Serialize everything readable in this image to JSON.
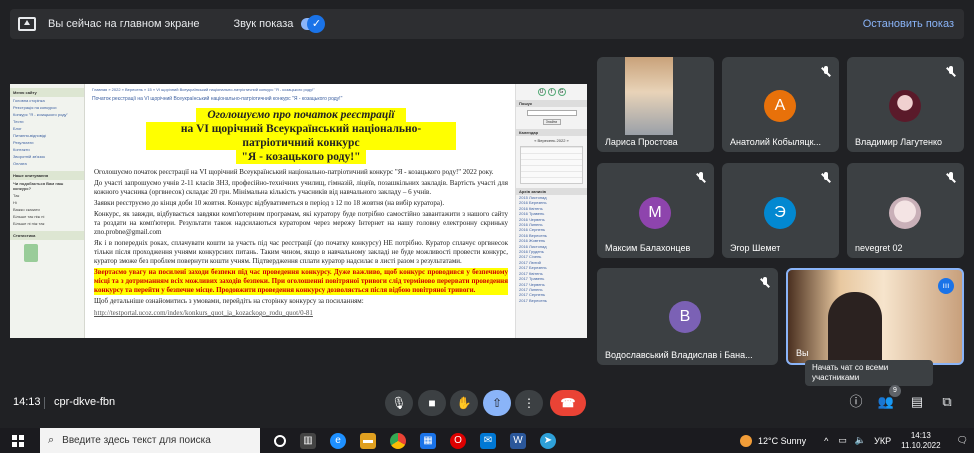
{
  "top_bar": {
    "presenting_text": "Вы сейчас на главном экране",
    "sound_label": "Звук показа",
    "stop_label": "Остановить показ"
  },
  "shared_screen": {
    "breadcrumb": "Главная » 2022 » Вересень » 15 » VI щорічний Всеукраїнський національно-патріотичний конкурс \"Я - козацького роду!\"",
    "page_title": "Початок реєстрації на VI щорічний Всеукраїнський національно-патріотичний конкурс \"Я - козацького роду!\"",
    "heading1": "Оголошуємо про початок реєстрації",
    "heading2": "на VI щорічний Всеукраїнський національно-патріотичний конкурс",
    "heading3": "\"Я - козацького роду!\"",
    "p1": "Оголошуємо початок реєстрації на VI щорічний Всеукраїнський національно-патріотичний конкурс \"Я - козацького роду!\" 2022 року.",
    "p2": "До участі запрошуємо учнів 2-11 класів ЗНЗ, професійно-технічних училищ, гімназій, ліцеїв, позашкільних закладів. Вартість участі для кожного учасника (оргвнесок) складає 20 грн. Мінімальна кількість учасників від навчального закладу – 6 учнів.",
    "p3": "Заявки реєструємо до кінця доби 10 жовтня. Конкурс відбуватиметься в період з 12 по 18 жовтня (на вибір куратора).",
    "p4": "Конкурс, як завжди, відбувається завдяки комп'ютерним програмам, які куратору буде потрібно самостійно завантажити з нашого сайту та роздати на комп'ютери. Результати також надсилаються куратором через мережу Інтернет на нашу головну електронну скриньку zno.probne@gmail.com",
    "p5": "Як і в попередніх роках, сплачувати кошти за участь під час реєстрації (до початку конкурсу) НЕ потрібно. Куратор сплачує оргвнесок тільки після проходження учнями конкурсних питань. Таким чином, якщо в навчальному закладі не буде можливості провести конкурс, куратор зможе без проблем повернути кошти учням. Підтвердження сплати куратор надсилає в листі разом з результатами.",
    "p6": "Звертаємо увагу на посилені заходи безпеки під час проведення конкурсу. Дуже важливо, щоб конкурс проводився у безпечному місці та з дотриманням всіх можливих заходів безпеки. При оголошенні повітряної тривоги слід терміново перервати проведення конкурсу та перейти у безпечне місце. Продовжити проведення конкурсу дозволяється після відбою повітряної тривоги.",
    "p7": "Щоб детальніше ознайомитись з умовами, перейдіть на сторінку конкурсу за посиланням:",
    "url": "http://testportal.ucoz.com/index/konkurs_quot_ja_kozackogo_rodu_quot/0-81",
    "left_sidebar": {
      "menu_header": "Меню сайту",
      "items": [
        "Головна сторінка",
        "Реєстрація на конкурси",
        "Конкурс \"Я - козацького роду\"",
        "Тести",
        "Блог",
        "Питання-відповіді",
        "Результати",
        "Контакти",
        "Зворотній зв'язок",
        "Оплата"
      ],
      "poll_header": "Наше опитування",
      "poll_question": "Чи подобається Вам наш конкурс?",
      "poll_options": [
        "Так",
        "Ні",
        "Важко сказати",
        "Більше так ніж ні",
        "Більше ні ніж так"
      ],
      "stats_header": "Статистика"
    },
    "right_sidebar": {
      "search_header": "Пошук",
      "search_button": "Знайти",
      "calendar_header": "Календар",
      "calendar_month": "« Вересень 2022 »",
      "archive_header": "Архів записів",
      "archive": [
        "2015 Листопад",
        "2016 Березень",
        "2016 Квітень",
        "2016 Травень",
        "2016 Червень",
        "2016 Липень",
        "2016 Серпень",
        "2016 Вересень",
        "2016 Жовтень",
        "2016 Листопад",
        "2016 Грудень",
        "2017 Січень",
        "2017 Лютий",
        "2017 Березень",
        "2017 Квітень",
        "2017 Травень",
        "2017 Червень",
        "2017 Липень",
        "2017 Серпень",
        "2017 Вересень"
      ]
    }
  },
  "participants": [
    {
      "name": "Лариса Простова",
      "initial": "",
      "color": ""
    },
    {
      "name": "Анатолий Кобыляцк...",
      "initial": "А",
      "color": "#e8710a"
    },
    {
      "name": "Владимир Лагутенко",
      "initial": "",
      "color": ""
    },
    {
      "name": "Максим Балахонцев",
      "initial": "М",
      "color": "#8e44ad"
    },
    {
      "name": "Эгор Шемет",
      "initial": "Э",
      "color": "#0288d1"
    },
    {
      "name": "nevegret 02",
      "initial": "",
      "color": ""
    },
    {
      "name": "Водославський Владислав і Бана...",
      "initial": "В",
      "color": "#7b61b5"
    },
    {
      "name": "Вы",
      "initial": "",
      "color": ""
    }
  ],
  "tooltip": "Начать чат со всеми участниками",
  "controls": {
    "time": "14:13",
    "meeting_code": "cpr-dkve-fbn",
    "participant_count": "9"
  },
  "taskbar": {
    "search_placeholder": "Введите здесь текст для поиска",
    "weather": "12°C Sunny",
    "language": "УКР",
    "time": "14:13",
    "date": "11.10.2022"
  }
}
